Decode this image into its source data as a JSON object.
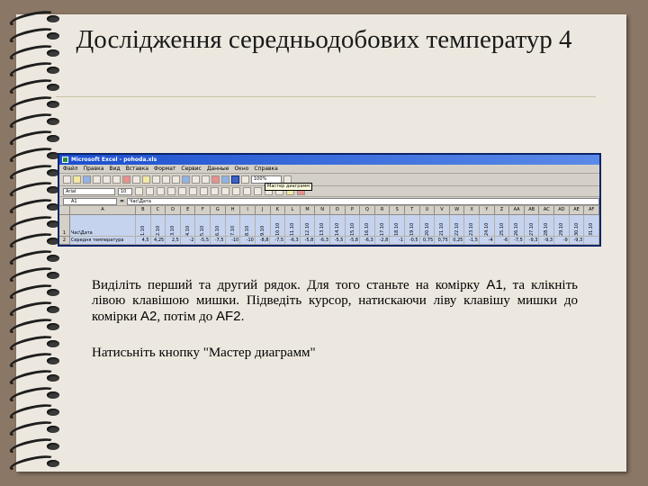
{
  "slide": {
    "title": "Дослідження середньодобових температур 4"
  },
  "excel": {
    "window_title": "Microsoft Excel - pohoda.xls",
    "menu": [
      "Файл",
      "Правка",
      "Вид",
      "Вставка",
      "Формат",
      "Сервис",
      "Данные",
      "Окно",
      "Справка"
    ],
    "zoom": "100%",
    "tooltip": "Мастер диаграмм",
    "font_name": "Arial",
    "font_size": "10",
    "name_box": "A1",
    "fx": "=",
    "formula": "Час\\Дата",
    "columns": [
      "A",
      "B",
      "C",
      "D",
      "E",
      "F",
      "G",
      "H",
      "I",
      "J",
      "K",
      "L",
      "M",
      "N",
      "O",
      "P",
      "Q",
      "R",
      "S",
      "T",
      "U",
      "V",
      "W",
      "X",
      "Y",
      "Z",
      "AA",
      "AB",
      "AC",
      "AD",
      "AE",
      "AF"
    ],
    "rows": [
      {
        "num": "1",
        "label": "Час\\Дата",
        "values": [
          "1.10",
          "2.10",
          "3.10",
          "4.10",
          "5.10",
          "6.10",
          "7.10",
          "8.10",
          "9.10",
          "10.10",
          "11.10",
          "12.10",
          "13.10",
          "14.10",
          "15.10",
          "16.10",
          "17.10",
          "18.10",
          "19.10",
          "20.10",
          "21.10",
          "22.10",
          "23.10",
          "24.10",
          "25.10",
          "26.10",
          "27.10",
          "28.10",
          "29.10",
          "30.10",
          "31.10"
        ]
      },
      {
        "num": "2",
        "label": "Середня температура",
        "values": [
          "4,5",
          "4,25",
          "2,5",
          "-2",
          "-5,5",
          "-7,5",
          "-10",
          "-10",
          "-8,8",
          "-7,5",
          "-6,3",
          "-5,8",
          "-6,3",
          "-5,5",
          "-5,8",
          "-6,3",
          "-2,8",
          "-1",
          "-0,5",
          "0,75",
          "0,75",
          "0,25",
          "-1,5",
          "-4",
          "-6",
          "-7,5",
          "-9,3",
          "-9,3",
          "-9",
          "-9,3"
        ]
      }
    ]
  },
  "instructions": {
    "p1_a": "Виділіть перший та другий рядок. Для того станьте на комірку ",
    "p1_b": "A1",
    "p1_c": ", та клікніть лівою клавішою мишки. Підведіть курсор, натискаючи ліву клавішу мишки до комірки ",
    "p1_d": "A2",
    "p1_e": ", потім до ",
    "p1_f": "AF2.",
    "p2_a": "Натисьніть кнопку ",
    "p2_b": "\"Мастер диаграмм\""
  }
}
